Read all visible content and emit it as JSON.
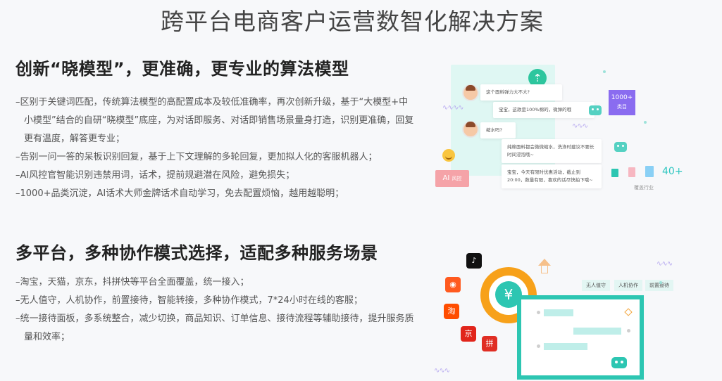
{
  "page_title": "跨平台电商客户运营数智化解决方案",
  "section1": {
    "title": "创新“晓模型”，更准确，更专业的算法模型",
    "bullets": [
      "–区别于关键词匹配，传统算法模型的高配置成本及较低准确率，再次创新升级，基于“大模型+中小模型”结合的自研“晓模型”底座，为对话即服务、对话即销售场景量身打造，识别更准确，回复更有温度，解答更专业；",
      "–告别一问一答的呆板识别回复，基于上下文理解的多轮回复，更加拟人化的客服机器人；",
      "–AI风控官智能识别违禁用词，话术，提前规避潜在风险，避免损失；",
      "–1000+品类沉淀，AI话术大师金牌话术自动学习，免去配置烦恼，越用越聪明；"
    ]
  },
  "section2": {
    "title": "多平台，多种协作模式选择，适配多种服务场景",
    "bullets": [
      "–淘宝，天猫，京东，抖拼快等平台全面覆盖，统一接入；",
      "–无人值守，人机协作，前置接待，智能转接，多种协作模式，7*24小时在线的客服；",
      "–统一接待面板，多系统整合，减少切换，商品知识、订单信息、接待流程等辅助接待，提升服务质量和效率；"
    ]
  },
  "illustration1": {
    "chat_q1": "这个面料弹力大不大?",
    "chat_a1": "宝宝，这款是100%棉的，微弹的哦",
    "chat_q2": "缩水吗?",
    "chat_a2": "纯棉面料都会微微缩水，洗涤时建议不要长时间浸泡哦~",
    "chat_a3": "宝宝，今天有限时优惠活动，截止到20:00，数量有限，喜欢的话尽快拍下哦~",
    "categories_count": "1000+",
    "categories_label": "类目",
    "ai_label": "AI",
    "ai_sub": "风控",
    "industry_count": "40+",
    "industry_label": "覆盖行业"
  },
  "illustration2": {
    "tags": [
      "无人值守",
      "人机协作",
      "前置接待"
    ],
    "platforms": [
      {
        "name": "douyin",
        "color": "#111111",
        "glyph": "♪"
      },
      {
        "name": "kuaishou",
        "color": "#ff5a1f",
        "glyph": "◉"
      },
      {
        "name": "taobao",
        "color": "#ff4d00",
        "glyph": "淘"
      },
      {
        "name": "jd",
        "color": "#e1251b",
        "glyph": "京"
      },
      {
        "name": "pinduoduo",
        "color": "#e02e24",
        "glyph": "拼"
      }
    ]
  },
  "colors": {
    "accent": "#2dc6b2",
    "orange": "#f7a11a",
    "purple": "#8a6cf0",
    "pink": "#f5a3a8"
  }
}
